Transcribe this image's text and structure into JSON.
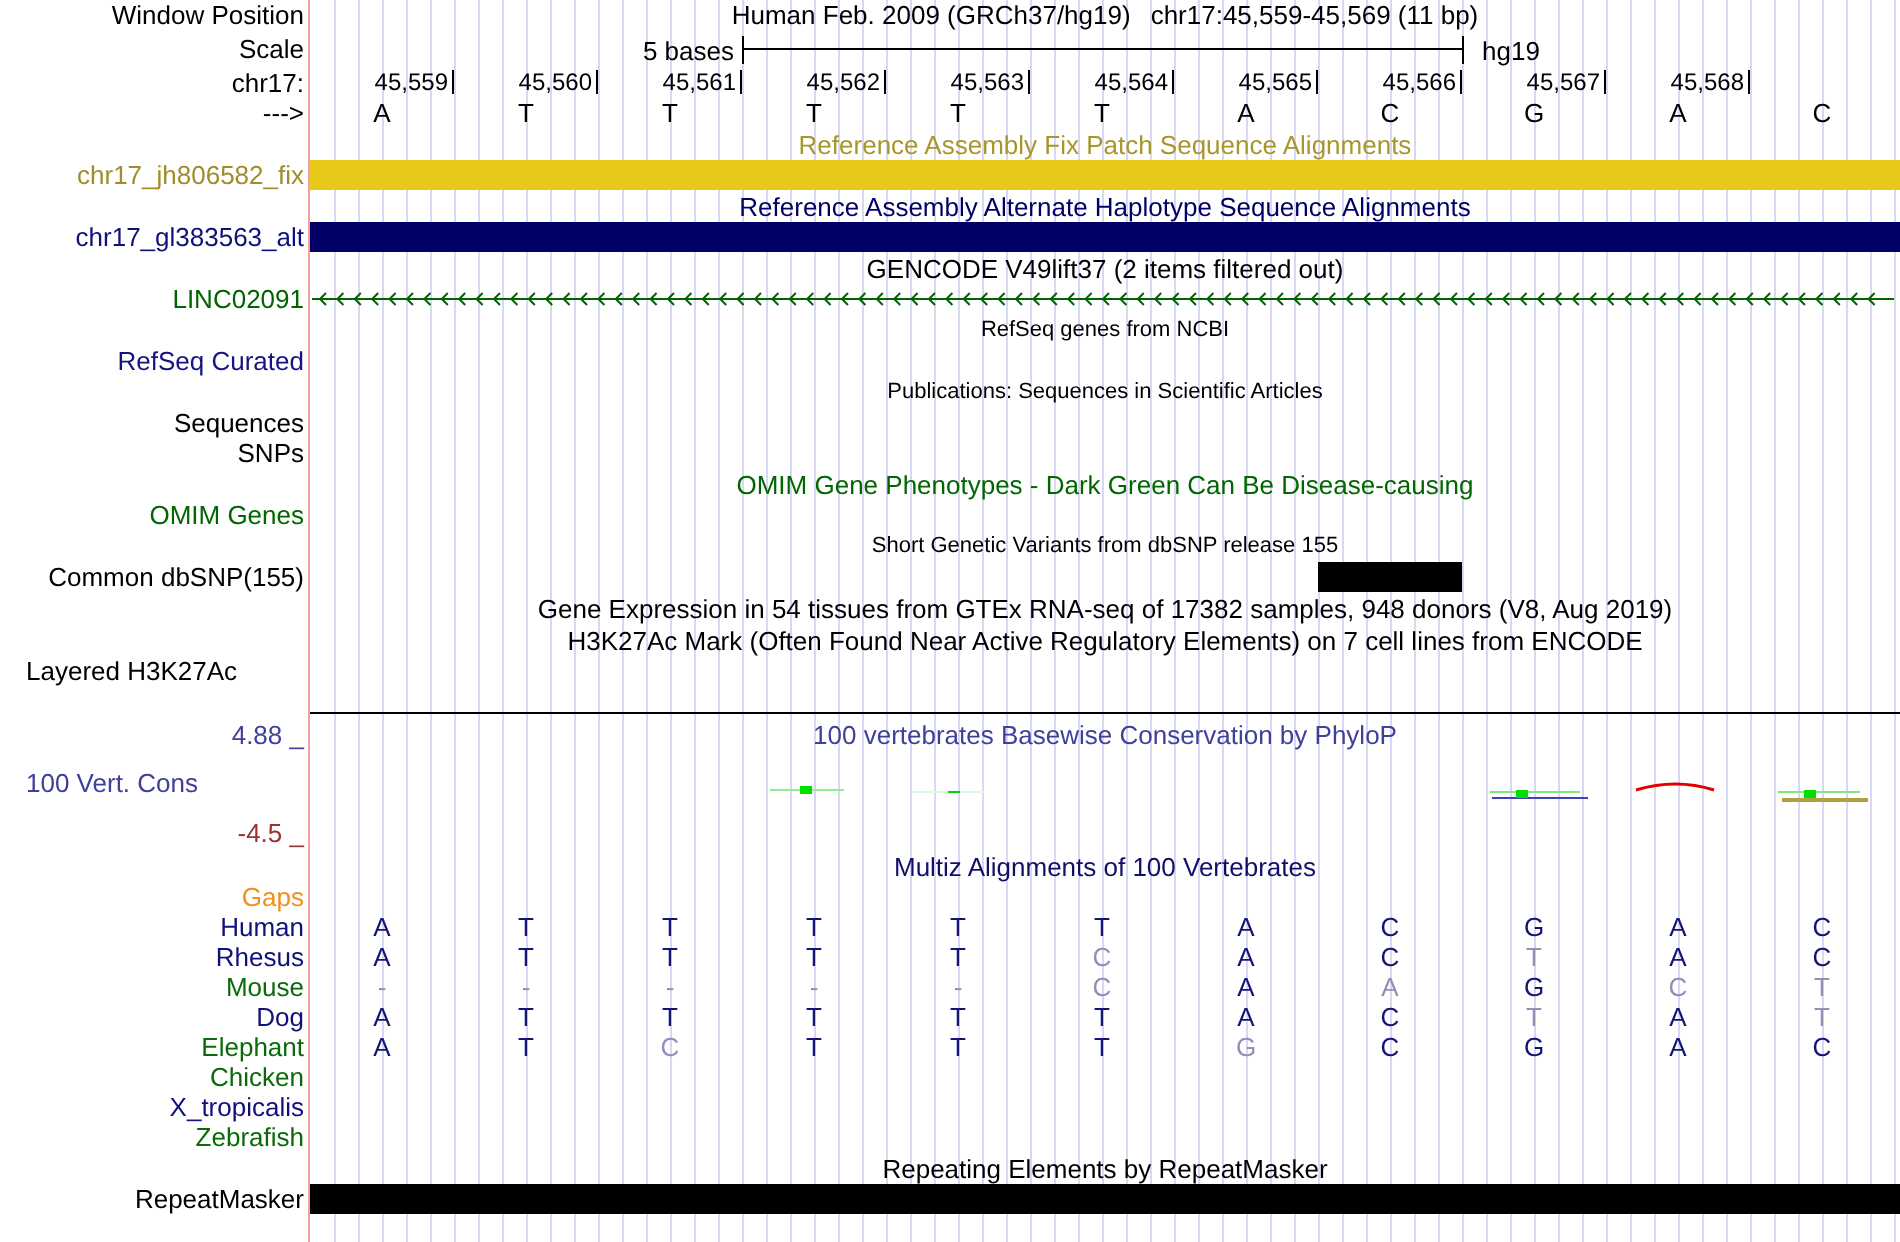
{
  "position": {
    "label": "Window Position",
    "assembly": "Human Feb. 2009 (GRCh37/hg19)",
    "range": "chr17:45,559-45,569 (11 bp)"
  },
  "scale": {
    "label": "Scale",
    "span": "5 bases",
    "assembly": "hg19"
  },
  "ruler": {
    "label": "chr17:",
    "ticks": [
      "45,559",
      "45,560",
      "45,561",
      "45,562",
      "45,563",
      "45,564",
      "45,565",
      "45,566",
      "45,567",
      "45,568"
    ]
  },
  "strand_bases": {
    "label": "--->",
    "bases": [
      "A",
      "T",
      "T",
      "T",
      "T",
      "T",
      "A",
      "C",
      "G",
      "A",
      "C"
    ]
  },
  "tracks": [
    {
      "kind": "title",
      "text": "Reference Assembly Fix Patch Sequence Alignments",
      "color": "#a8962a"
    },
    {
      "kind": "bar",
      "label": "chr17_jh806582_fix",
      "color": "#a08c28",
      "feature": {
        "color": "#e8c818"
      }
    },
    {
      "kind": "title",
      "text": "Reference Assembly Alternate Haplotype Sequence Alignments",
      "color": "#000066"
    },
    {
      "kind": "bar",
      "label": "chr17_gl383563_alt",
      "color": "#10107a",
      "feature": {
        "color": "#000066"
      }
    },
    {
      "kind": "title",
      "text": "GENCODE V49lift37 (2 items filtered out)",
      "color": "#000000"
    },
    {
      "kind": "gene",
      "label": "LINC02091",
      "color": "#006400"
    },
    {
      "kind": "note",
      "text": "RefSeq genes from NCBI",
      "color": "#000000"
    },
    {
      "kind": "label",
      "label": "RefSeq Curated",
      "color": "#141482"
    },
    {
      "kind": "note",
      "text": "Publications: Sequences in Scientific Articles",
      "color": "#000000"
    },
    {
      "kind": "label",
      "label": "Sequences",
      "color": "#000000"
    },
    {
      "kind": "label",
      "label": "SNPs",
      "color": "#000000"
    },
    {
      "kind": "title",
      "text": "OMIM Gene Phenotypes - Dark Green Can Be Disease-causing",
      "color": "#006600"
    },
    {
      "kind": "label",
      "label": "OMIM Genes",
      "color": "#006600"
    },
    {
      "kind": "note",
      "text": "Short Genetic Variants from dbSNP release 155",
      "color": "#000000"
    },
    {
      "kind": "variants",
      "label": "Common dbSNP(155)",
      "color": "#000000",
      "marks": [
        false,
        false,
        false,
        false,
        false,
        false,
        false,
        true,
        false,
        false,
        false
      ]
    },
    {
      "kind": "title",
      "text": "Gene Expression in 54 tissues from GTEx RNA-seq of 17382 samples, 948 donors (V8, Aug 2019)",
      "color": "#000000"
    },
    {
      "kind": "title",
      "text": "H3K27Ac Mark (Often Found Near Active Regulatory Elements) on 7 cell lines from ENCODE",
      "color": "#000000"
    },
    {
      "kind": "composite",
      "label": "Layered H3K27Ac",
      "color": "#000000"
    },
    {
      "kind": "divider"
    },
    {
      "kind": "wiggle",
      "title": "100 vertebrates Basewise Conservation by PhyloP",
      "label": "100 Vert. Cons",
      "max": "4.88 _",
      "min": "-4.5 _",
      "color": "#40409a"
    },
    {
      "kind": "title",
      "text": "Multiz Alignments of 100 Vertebrates",
      "color": "#10106a"
    },
    {
      "kind": "label",
      "label": "Gaps",
      "color": "#f0901c"
    },
    {
      "kind": "alignment",
      "label": "Human",
      "color": "#10107a",
      "bases": [
        {
          "base": "A",
          "match": true
        },
        {
          "base": "T",
          "match": true
        },
        {
          "base": "T",
          "match": true
        },
        {
          "base": "T",
          "match": true
        },
        {
          "base": "T",
          "match": true
        },
        {
          "base": "T",
          "match": true
        },
        {
          "base": "A",
          "match": true
        },
        {
          "base": "C",
          "match": true
        },
        {
          "base": "G",
          "match": true
        },
        {
          "base": "A",
          "match": true
        },
        {
          "base": "C",
          "match": true
        }
      ]
    },
    {
      "kind": "alignment",
      "label": "Rhesus",
      "color": "#10107a",
      "bases": [
        {
          "base": "A",
          "match": true
        },
        {
          "base": "T",
          "match": true
        },
        {
          "base": "T",
          "match": true
        },
        {
          "base": "T",
          "match": true
        },
        {
          "base": "T",
          "match": true
        },
        {
          "base": "C",
          "match": false
        },
        {
          "base": "A",
          "match": true
        },
        {
          "base": "C",
          "match": true
        },
        {
          "base": "T",
          "match": false
        },
        {
          "base": "A",
          "match": true
        },
        {
          "base": "C",
          "match": true
        }
      ]
    },
    {
      "kind": "alignment",
      "label": "Mouse",
      "color": "#0a6a0a",
      "bases": [
        {
          "base": "-",
          "match": false
        },
        {
          "base": "-",
          "match": false
        },
        {
          "base": "-",
          "match": false
        },
        {
          "base": "-",
          "match": false
        },
        {
          "base": "-",
          "match": false
        },
        {
          "base": "C",
          "match": false
        },
        {
          "base": "A",
          "match": true
        },
        {
          "base": "A",
          "match": false
        },
        {
          "base": "G",
          "match": true
        },
        {
          "base": "C",
          "match": false
        },
        {
          "base": "T",
          "match": false
        }
      ]
    },
    {
      "kind": "alignment",
      "label": "Dog",
      "color": "#10107a",
      "bases": [
        {
          "base": "A",
          "match": true
        },
        {
          "base": "T",
          "match": true
        },
        {
          "base": "T",
          "match": true
        },
        {
          "base": "T",
          "match": true
        },
        {
          "base": "T",
          "match": true
        },
        {
          "base": "T",
          "match": true
        },
        {
          "base": "A",
          "match": true
        },
        {
          "base": "C",
          "match": true
        },
        {
          "base": "T",
          "match": false
        },
        {
          "base": "A",
          "match": true
        },
        {
          "base": "T",
          "match": false
        }
      ]
    },
    {
      "kind": "alignment",
      "label": "Elephant",
      "color": "#0a6a0a",
      "bases": [
        {
          "base": "A",
          "match": true
        },
        {
          "base": "T",
          "match": true
        },
        {
          "base": "C",
          "match": false
        },
        {
          "base": "T",
          "match": true
        },
        {
          "base": "T",
          "match": true
        },
        {
          "base": "T",
          "match": true
        },
        {
          "base": "G",
          "match": false
        },
        {
          "base": "C",
          "match": true
        },
        {
          "base": "G",
          "match": true
        },
        {
          "base": "A",
          "match": true
        },
        {
          "base": "C",
          "match": true
        }
      ]
    },
    {
      "kind": "alignment",
      "label": "Chicken",
      "color": "#0a6a0a"
    },
    {
      "kind": "alignment",
      "label": "X_tropicalis",
      "color": "#10107a"
    },
    {
      "kind": "alignment",
      "label": "Zebrafish",
      "color": "#0a6a0a"
    },
    {
      "kind": "title",
      "text": "Repeating Elements by RepeatMasker",
      "color": "#000000"
    },
    {
      "kind": "bar",
      "label": "RepeatMasker",
      "color": "#000000",
      "feature": {
        "color": "#000000"
      }
    }
  ]
}
